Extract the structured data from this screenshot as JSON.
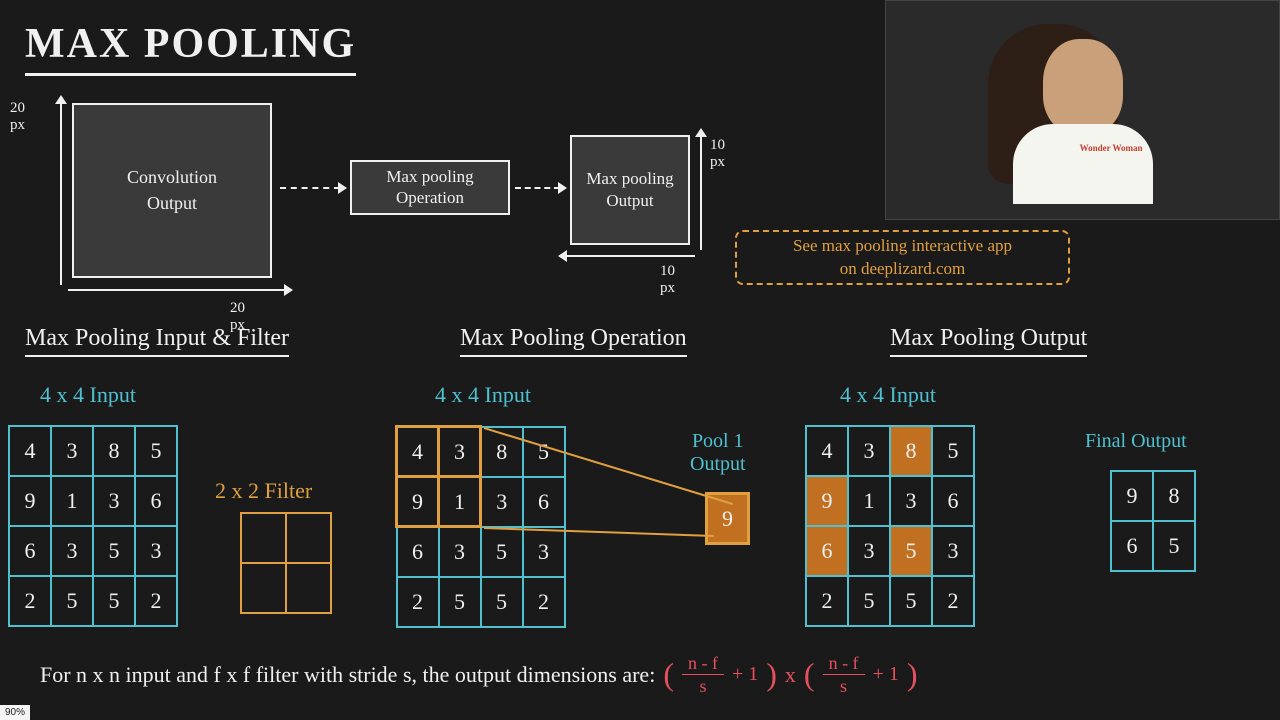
{
  "title": "MAX POOLING",
  "flow": {
    "conv_box": "Convolution\nOutput",
    "op_box": "Max pooling\nOperation",
    "out_box": "Max pooling\nOutput",
    "dim_20px_v": "20 px",
    "dim_20px_h": "20 px",
    "dim_10px_v": "10 px",
    "dim_10px_h": "10 px"
  },
  "note": "See max pooling interactive app\non deeplizard.com",
  "sections": {
    "input_filter": "Max Pooling Input & Filter",
    "operation": "Max Pooling Operation",
    "output": "Max Pooling Output"
  },
  "labels": {
    "input_4x4": "4 x 4 Input",
    "filter_2x2": "2 x 2 Filter",
    "pool1_output": "Pool 1\nOutput",
    "final_output": "Final Output"
  },
  "grids": {
    "input1": [
      [
        4,
        3,
        8,
        5
      ],
      [
        9,
        1,
        3,
        6
      ],
      [
        6,
        3,
        5,
        3
      ],
      [
        2,
        5,
        5,
        2
      ]
    ],
    "input2": [
      [
        4,
        3,
        8,
        5
      ],
      [
        9,
        1,
        3,
        6
      ],
      [
        6,
        3,
        5,
        3
      ],
      [
        2,
        5,
        5,
        2
      ]
    ],
    "input3": [
      [
        4,
        3,
        8,
        5
      ],
      [
        9,
        1,
        3,
        6
      ],
      [
        6,
        3,
        5,
        3
      ],
      [
        2,
        5,
        5,
        2
      ]
    ],
    "input3_highlights": [
      [
        false,
        false,
        true,
        false
      ],
      [
        true,
        false,
        false,
        false
      ],
      [
        true,
        false,
        true,
        false
      ],
      [
        false,
        false,
        false,
        false
      ]
    ],
    "pool_result": 9,
    "final": [
      [
        9,
        8
      ],
      [
        6,
        5
      ]
    ]
  },
  "formula": {
    "text": "For n x n input and f x f filter with stride s, the output dimensions are:",
    "num": "n - f",
    "den": "s",
    "plus": "+ 1",
    "times": "x"
  },
  "zoom": "90%",
  "webcam_shirt": "Wonder\nWoman"
}
